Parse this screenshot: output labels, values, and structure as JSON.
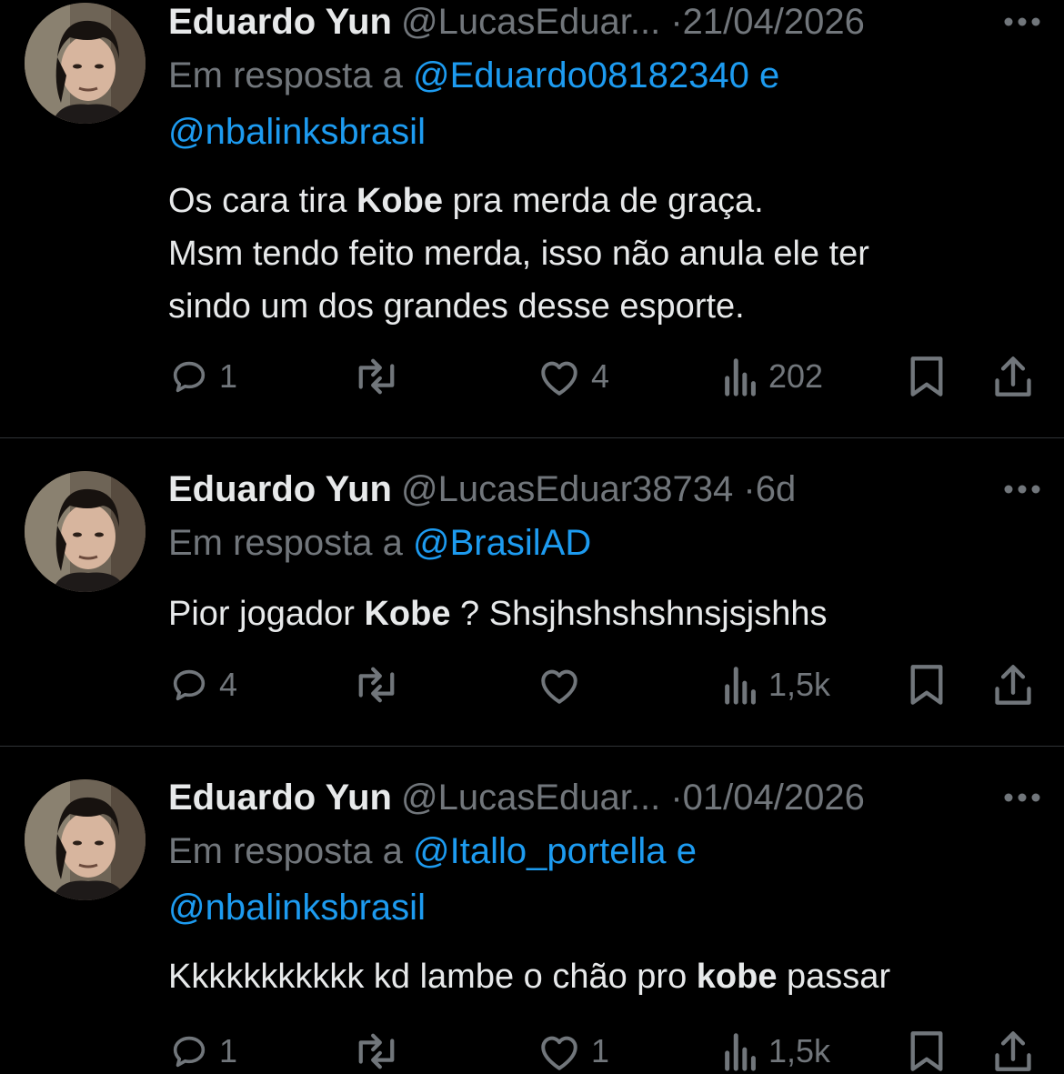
{
  "tweets": [
    {
      "display_name": "Eduardo Yun",
      "handle": "@LucasEduar...",
      "separator": "·",
      "time": "21/04/2026",
      "reply_prefix": "Em resposta a",
      "reply_mention_1": "@Eduardo08182340",
      "reply_conjunction": "e",
      "reply_mention_2": "@nbalinksbrasil",
      "text_parts": [
        "Os cara tira ",
        "Kobe",
        " pra merda de graça.",
        "Msm tendo feito merda, isso não anula ele ter",
        "sindo um dos grandes desse esporte."
      ],
      "replies": "1",
      "retweets": "",
      "likes": "4",
      "views": "202"
    },
    {
      "display_name": "Eduardo Yun",
      "handle": "@LucasEduar38734",
      "separator": "·",
      "time": "6d",
      "reply_prefix": "Em resposta a",
      "reply_mention_1": "@BrasilAD",
      "text_parts": [
        "Pior jogador ",
        "Kobe",
        " ? Shsjhshshshnsjsjshhs"
      ],
      "replies": "4",
      "retweets": "",
      "likes": "",
      "views": "1,5k"
    },
    {
      "display_name": "Eduardo Yun",
      "handle": "@LucasEduar...",
      "separator": "·",
      "time": "01/04/2026",
      "reply_prefix": "Em resposta a",
      "reply_mention_1": "@Itallo_portella",
      "reply_conjunction": "e",
      "reply_mention_2": "@nbalinksbrasil",
      "text_parts": [
        "Kkkkkkkkkkk kd lambe o chão pro ",
        "kobe",
        " passar"
      ],
      "replies": "1",
      "retweets": "",
      "likes": "1",
      "views": "1,5k"
    }
  ],
  "colors": {
    "background": "#000000",
    "primary_text": "#e7e9ea",
    "secondary_text": "#71767b",
    "mention": "#1d9bf0",
    "divider": "#2f3336"
  },
  "icons": [
    "reply-icon",
    "retweet-icon",
    "like-icon",
    "views-icon",
    "bookmark-icon",
    "share-icon",
    "more-icon"
  ]
}
